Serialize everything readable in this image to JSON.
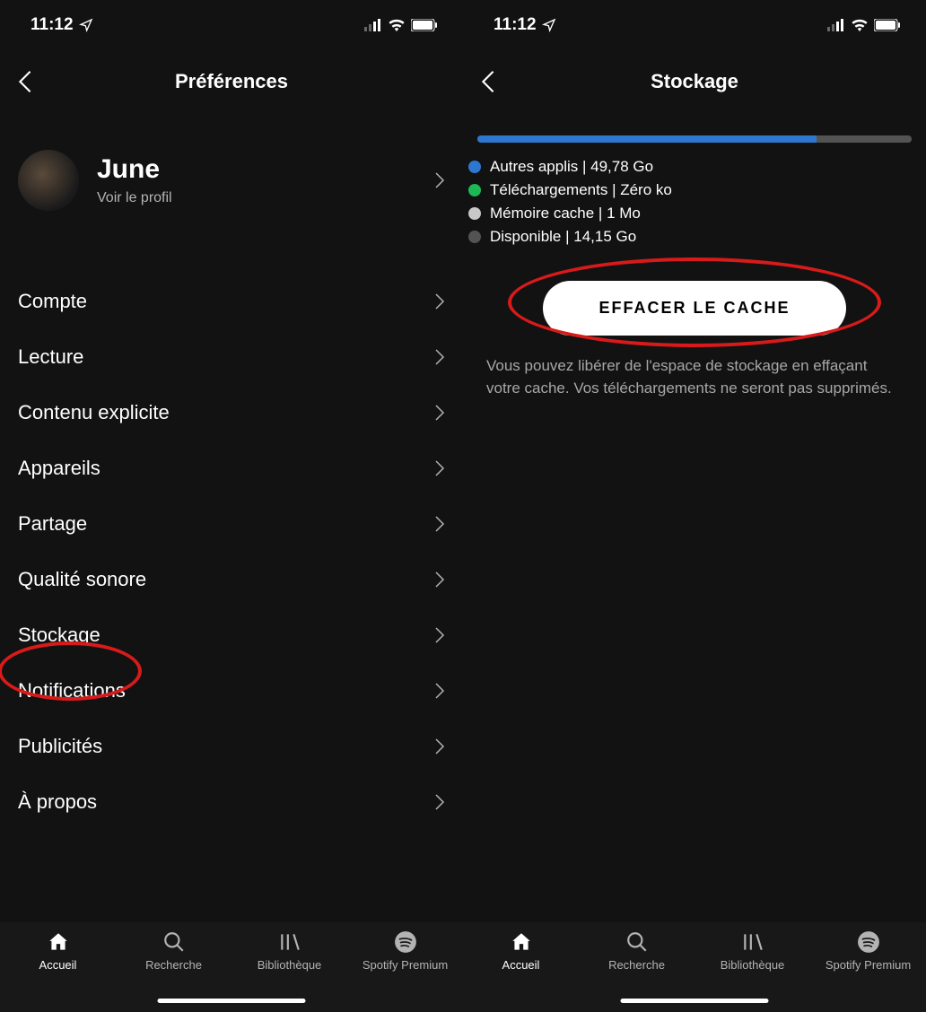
{
  "status": {
    "time": "11:12"
  },
  "left": {
    "headerTitle": "Préférences",
    "profile": {
      "name": "June",
      "subtitle": "Voir le profil"
    },
    "items": [
      "Compte",
      "Lecture",
      "Contenu explicite",
      "Appareils",
      "Partage",
      "Qualité sonore",
      "Stockage",
      "Notifications",
      "Publicités",
      "À propos"
    ]
  },
  "right": {
    "headerTitle": "Stockage",
    "legend": [
      {
        "color": "#2e77d0",
        "label": "Autres applis | 49,78 Go"
      },
      {
        "color": "#1db954",
        "label": "Téléchargements | Zéro ko"
      },
      {
        "color": "#c8c8c8",
        "label": "Mémoire cache | 1 Mo"
      },
      {
        "color": "#535353",
        "label": "Disponible | 14,15 Go"
      }
    ],
    "clearButton": "EFFACER LE CACHE",
    "hint": "Vous pouvez libérer de l'espace de stockage en effaçant votre cache. Vos téléchargements ne seront pas supprimés."
  },
  "tabs": [
    "Accueil",
    "Recherche",
    "Bibliothèque",
    "Spotify Premium"
  ],
  "colors": {
    "accentBlue": "#2e77d0",
    "accentGreen": "#1db954",
    "annotationRed": "#d91a1a"
  }
}
